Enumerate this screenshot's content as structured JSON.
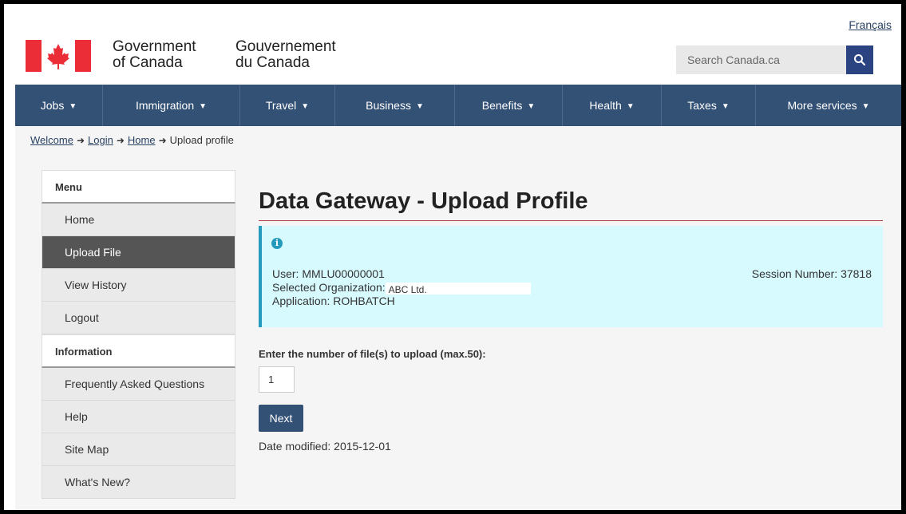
{
  "header": {
    "language_link": "Français",
    "gov_en_line1": "Government",
    "gov_en_line2": "of Canada",
    "gov_fr_line1": "Gouvernement",
    "gov_fr_line2": "du Canada",
    "search_placeholder": "Search Canada.ca",
    "search_icon": "magnifier-icon"
  },
  "nav": {
    "items": [
      {
        "label": "Jobs"
      },
      {
        "label": "Immigration"
      },
      {
        "label": "Travel"
      },
      {
        "label": "Business"
      },
      {
        "label": "Benefits"
      },
      {
        "label": "Health"
      },
      {
        "label": "Taxes"
      },
      {
        "label": "More services"
      }
    ]
  },
  "breadcrumb": {
    "items": [
      "Welcome",
      "Login",
      "Home"
    ],
    "current": "Upload profile"
  },
  "sidebar": {
    "menu_heading": "Menu",
    "menu_items": [
      "Home",
      "Upload File",
      "View History",
      "Logout"
    ],
    "active_item": "Upload File",
    "info_heading": "Information",
    "info_items": [
      "Frequently Asked Questions",
      "Help",
      "Site Map",
      "What's New?"
    ]
  },
  "main": {
    "title": "Data Gateway - Upload Profile",
    "info_panel": {
      "user": "User: MMLU00000001",
      "org_label": "Selected Organization:",
      "org_value": "ABC Ltd.",
      "application": "Application: ROHBATCH",
      "session": "Session Number: 37818"
    },
    "file_count_label": "Enter the number of file(s) to upload (max.50):",
    "file_count_value": "1",
    "next_label": "Next",
    "date_modified": "Date modified: 2015-12-01"
  },
  "colors": {
    "nav_bg": "#335075",
    "flag_red": "#eb2d37",
    "rule_red": "#af3c43",
    "info_bg": "#d7faff",
    "info_accent": "#269abc"
  }
}
